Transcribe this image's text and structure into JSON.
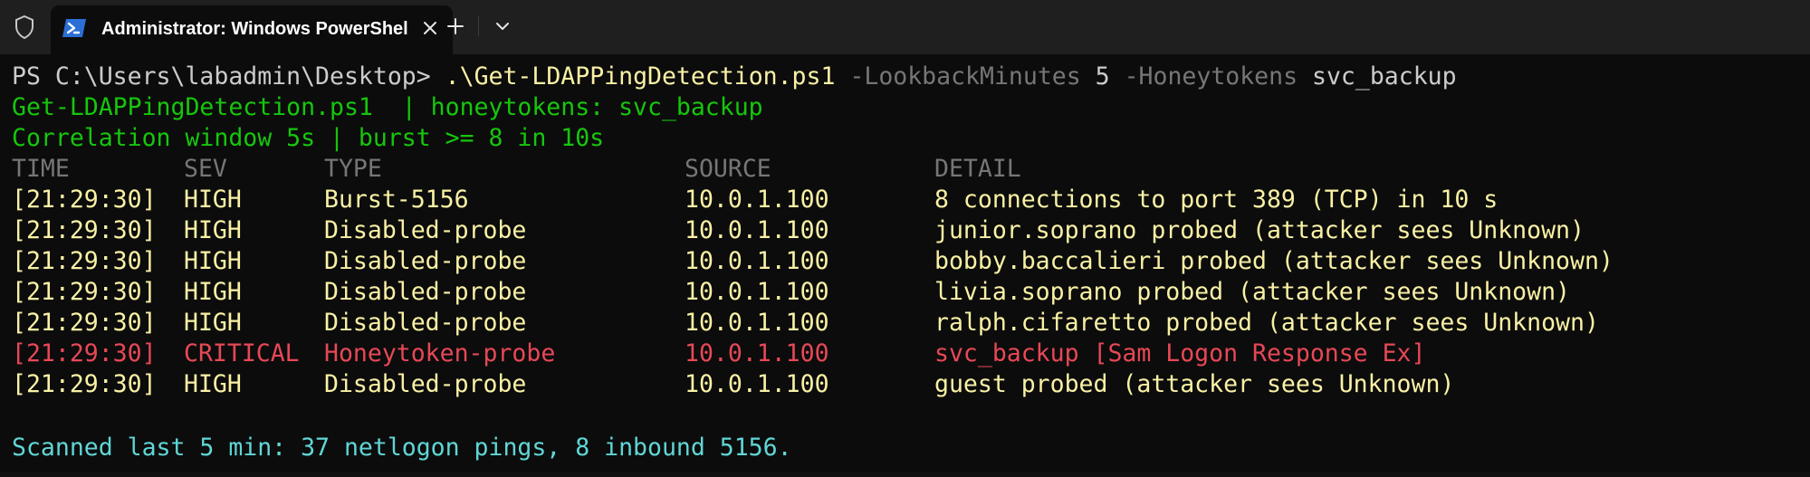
{
  "tab": {
    "title": "Administrator: Windows PowerShell"
  },
  "icons": {
    "shield": "shield-icon",
    "powershell": "powershell-icon",
    "close": "close-icon",
    "add": "plus-icon",
    "dropdown": "chevron-down-icon"
  },
  "colors": {
    "background": "#0c0c0c",
    "tabstrip": "#1f1f1f",
    "green": "#16c60c",
    "yellow": "#f9f1a5",
    "red": "#e74856",
    "cyan": "#61d6d6",
    "gray": "#767676"
  },
  "command": {
    "prompt": "PS C:\\Users\\labadmin\\Desktop>",
    "script": ".\\Get-LDAPPingDetection.ps1",
    "param1": "-LookbackMinutes",
    "value1": "5",
    "param2": "-Honeytokens",
    "value2": "svc_backup"
  },
  "banner": {
    "line1": "Get-LDAPPingDetection.ps1  | honeytokens: svc_backup",
    "line2": "Correlation window 5s | burst >= 8 in 10s"
  },
  "table": {
    "headers": {
      "time": "TIME",
      "sev": "SEV",
      "type": "TYPE",
      "source": "SOURCE",
      "detail": "DETAIL"
    },
    "rows": [
      {
        "time": "[21:29:30]",
        "sev": "HIGH",
        "type": "Burst-5156",
        "source": "10.0.1.100",
        "detail": "8 connections to port 389 (TCP) in 10 s"
      },
      {
        "time": "[21:29:30]",
        "sev": "HIGH",
        "type": "Disabled-probe",
        "source": "10.0.1.100",
        "detail": "junior.soprano probed (attacker sees Unknown)"
      },
      {
        "time": "[21:29:30]",
        "sev": "HIGH",
        "type": "Disabled-probe",
        "source": "10.0.1.100",
        "detail": "bobby.baccalieri probed (attacker sees Unknown)"
      },
      {
        "time": "[21:29:30]",
        "sev": "HIGH",
        "type": "Disabled-probe",
        "source": "10.0.1.100",
        "detail": "livia.soprano probed (attacker sees Unknown)"
      },
      {
        "time": "[21:29:30]",
        "sev": "HIGH",
        "type": "Disabled-probe",
        "source": "10.0.1.100",
        "detail": "ralph.cifaretto probed (attacker sees Unknown)"
      },
      {
        "time": "[21:29:30]",
        "sev": "CRITICAL",
        "type": "Honeytoken-probe",
        "source": "10.0.1.100",
        "detail": "svc_backup [Sam Logon Response Ex]"
      },
      {
        "time": "[21:29:30]",
        "sev": "HIGH",
        "type": "Disabled-probe",
        "source": "10.0.1.100",
        "detail": "guest probed (attacker sees Unknown)"
      }
    ]
  },
  "summary": "Scanned last 5 min: 37 netlogon pings, 8 inbound 5156."
}
